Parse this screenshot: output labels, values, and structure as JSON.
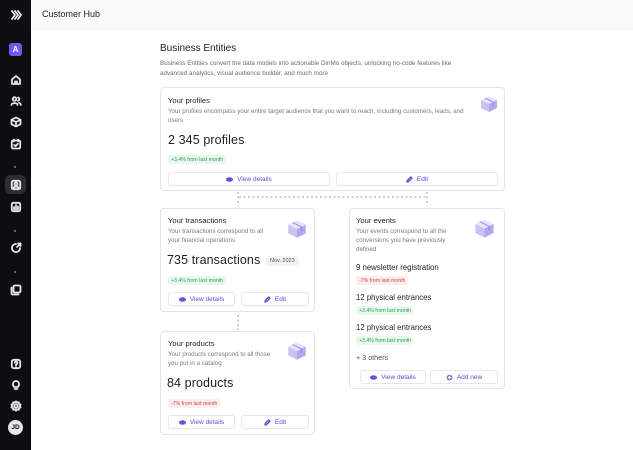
{
  "sidebar": {
    "workspace_initial": "A",
    "user_initials": "JD"
  },
  "topbar": {
    "title": "Customer Hub"
  },
  "page": {
    "title": "Business Entities",
    "description": "Business Entities convert the data models into actionable DinMo objects, unlocking no-code features like advanced analytics, visual audience builder, and much more"
  },
  "profiles": {
    "title": "Your profiles",
    "description": "Your profiles encompass your entire target audience that you want to reach, including customers, leads, and users",
    "count": "2 345 profiles",
    "trend": "+3.4% from last month",
    "view_label": "View details",
    "edit_label": "Edit"
  },
  "transactions": {
    "title": "Your transactions",
    "description": "Your transactions correspond to all your financial operations",
    "count": "735 transactions",
    "date": "Nov. 2023",
    "trend": "+3.4% from last month",
    "view_label": "View details",
    "edit_label": "Edit"
  },
  "products": {
    "title": "Your products",
    "description": "Your products correspond to all those you put in a catalog",
    "count": "84 products",
    "trend": "-7% from last month",
    "view_label": "View details",
    "edit_label": "Edit"
  },
  "events": {
    "title": "Your events",
    "description": "Your events correspond to all the conversions you have previously defined",
    "items": [
      {
        "label": "9 newsletter registration",
        "trend": "-7% from last month"
      },
      {
        "label": "12 physical entrances",
        "trend": "+3.4% from last month"
      },
      {
        "label": "12 physical entrances",
        "trend": "+3.4% from last month"
      }
    ],
    "more": "+ 3 others",
    "view_label": "View details",
    "add_label": "Add new"
  },
  "colors": {
    "accent": "#5b4ed8",
    "sidebar_bg": "#0e0e10",
    "positive": "#2e9e56",
    "negative": "#d84545"
  }
}
